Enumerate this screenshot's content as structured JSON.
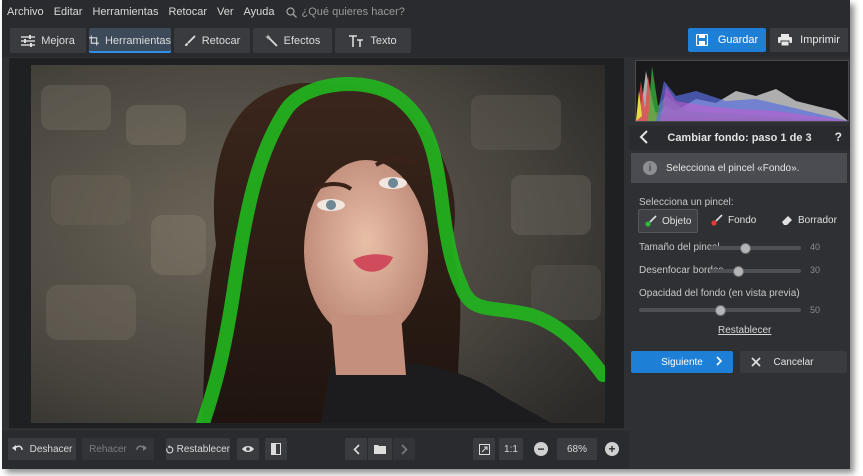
{
  "menu": {
    "items": [
      "Archivo",
      "Editar",
      "Herramientas",
      "Retocar",
      "Ver",
      "Ayuda"
    ],
    "search_placeholder": "¿Qué quieres hacer?"
  },
  "tabs": [
    {
      "label": "Mejora",
      "icon": "sliders-icon"
    },
    {
      "label": "Herramientas",
      "icon": "crop-icon",
      "active": true
    },
    {
      "label": "Retocar",
      "icon": "brush-icon"
    },
    {
      "label": "Efectos",
      "icon": "magic-wand-icon"
    },
    {
      "label": "Texto",
      "icon": "text-icon"
    }
  ],
  "actions": {
    "save": "Guardar",
    "print": "Imprimir"
  },
  "panel": {
    "title": "Cambiar fondo: paso 1 de 3",
    "help": "?",
    "info": "Selecciona el pincel «Fondo».",
    "brush_label": "Selecciona un pincel:",
    "brushes": [
      {
        "label": "Objeto",
        "color": "#2db83d",
        "active": true
      },
      {
        "label": "Fondo",
        "color": "#e03a3a"
      },
      {
        "label": "Borrador"
      }
    ],
    "sliders": [
      {
        "label": "Tamaño del pincel",
        "value": "40",
        "fraction": 0.4
      },
      {
        "label": "Desenfocar bordes",
        "value": "30",
        "fraction": 0.3
      },
      {
        "label": "Opacidad del fondo (en vista previa)",
        "value": "50",
        "fraction": 0.5
      }
    ],
    "reset": "Restablecer",
    "next": "Siguiente",
    "cancel": "Cancelar"
  },
  "bottom": {
    "undo": "Deshacer",
    "redo": "Rehacer",
    "reset": "Restablecer",
    "one_to_one": "1:1",
    "zoom": "68%"
  },
  "colors": {
    "accent": "#1e7fd6",
    "mask": "#22b41e"
  }
}
